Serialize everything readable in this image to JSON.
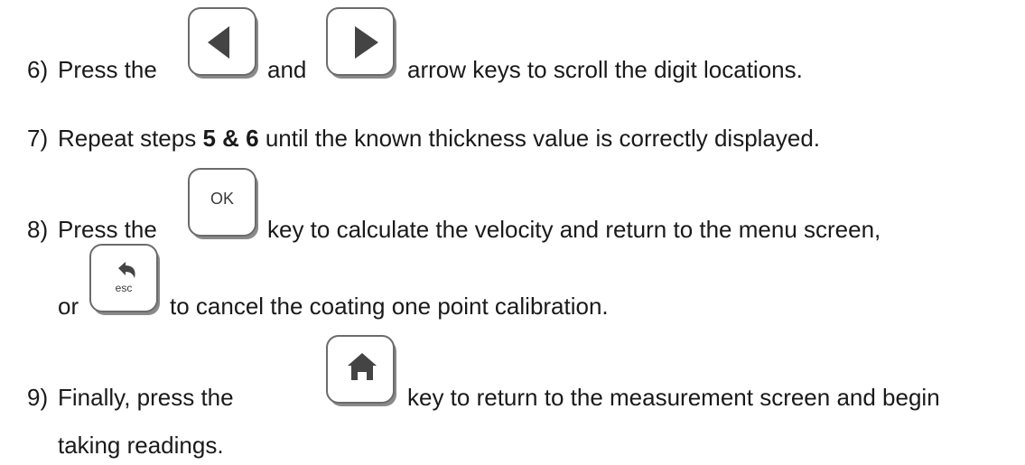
{
  "steps": [
    {
      "num": "6)",
      "pre": "Press the",
      "mid": "and",
      "post": "arrow keys to scroll the digit locations."
    },
    {
      "num": "7)",
      "pre": "Repeat steps",
      "bold": "5 & 6",
      "post": "until the known thickness value is correctly displayed."
    },
    {
      "num": "8)",
      "pre": "Press the",
      "post": "key to calculate the velocity and return to the menu screen,",
      "line2_pre": "or",
      "line2_post": "to cancel the coating one point calibration."
    },
    {
      "num": "9)",
      "pre": "Finally, press the",
      "post": "key to return to the measurement screen and begin",
      "line2": "taking readings."
    }
  ],
  "keys": {
    "left_arrow": "left-arrow-icon",
    "right_arrow": "right-arrow-icon",
    "ok": "OK",
    "esc": "esc",
    "esc_icon": "back-arrow-icon",
    "home": "home-icon"
  },
  "colors": {
    "text": "#1a1a1a",
    "key_border": "#6b6b6b",
    "icon": "#444444"
  }
}
